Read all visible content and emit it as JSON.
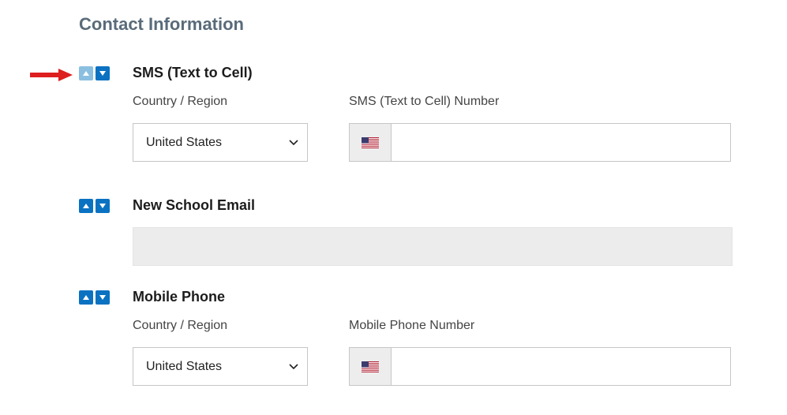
{
  "page_title": "Contact Information",
  "sections": {
    "sms": {
      "header": "SMS (Text to Cell)",
      "country_label": "Country / Region",
      "country_value": "United States",
      "number_label": "SMS (Text to Cell) Number",
      "number_value": ""
    },
    "email": {
      "header": "New School Email",
      "value": ""
    },
    "mobile": {
      "header": "Mobile Phone",
      "country_label": "Country / Region",
      "country_value": "United States",
      "number_label": "Mobile Phone Number",
      "number_value": ""
    }
  }
}
